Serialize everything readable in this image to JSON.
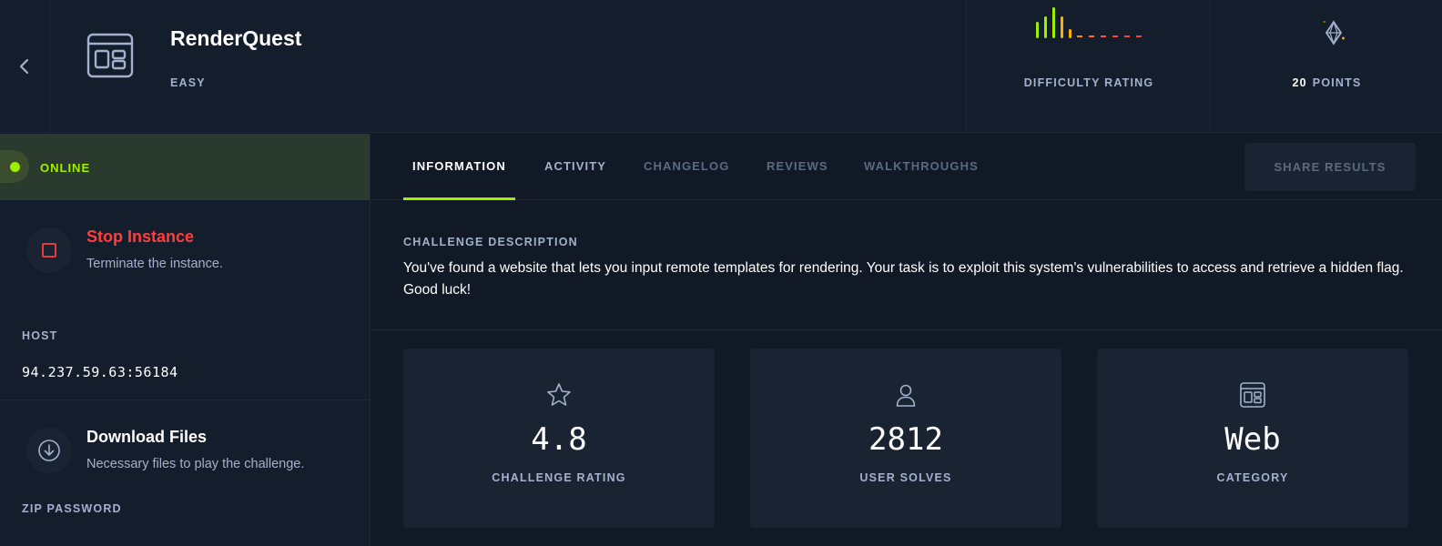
{
  "header": {
    "title": "RenderQuest",
    "difficulty": "EASY",
    "difficulty_label": "DIFFICULTY RATING",
    "points_value": "20",
    "points_label": "POINTS"
  },
  "sidebar": {
    "status": "ONLINE",
    "stop_title": "Stop Instance",
    "stop_desc": "Terminate the instance.",
    "host_label": "HOST",
    "host_value": "94.237.59.63:56184",
    "download_title": "Download Files",
    "download_desc": "Necessary files to play the challenge.",
    "zip_label": "ZIP PASSWORD"
  },
  "tabs": [
    {
      "label": "INFORMATION"
    },
    {
      "label": "ACTIVITY"
    },
    {
      "label": "CHANGELOG"
    },
    {
      "label": "REVIEWS"
    },
    {
      "label": "WALKTHROUGHS"
    }
  ],
  "share_label": "SHARE RESULTS",
  "description": {
    "label": "CHALLENGE DESCRIPTION",
    "text": "You've found a website that lets you input remote templates for rendering. Your task is to exploit this system's vulnerabilities to access and retrieve a hidden flag. Good luck!"
  },
  "stats": [
    {
      "value": "4.8",
      "label": "CHALLENGE RATING",
      "icon": "star-icon"
    },
    {
      "value": "2812",
      "label": "USER SOLVES",
      "icon": "user-icon"
    },
    {
      "value": "Web",
      "label": "CATEGORY",
      "icon": "web-category-icon"
    }
  ],
  "colors": {
    "accent_green": "#9fef00",
    "stop_red": "#ff3e3e",
    "difficulty_orange": "#ffaf00",
    "difficulty_red": "#ff3e3e",
    "muted": "#a4b1cd"
  }
}
